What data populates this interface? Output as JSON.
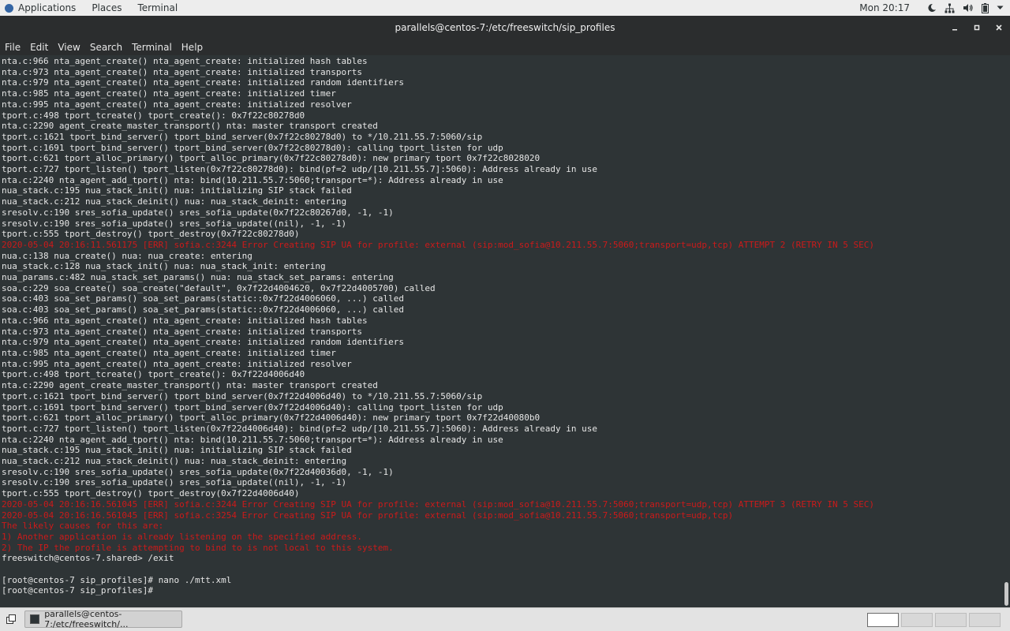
{
  "topbar": {
    "applications": "Applications",
    "places": "Places",
    "terminal": "Terminal",
    "clock": "Mon 20:17"
  },
  "window": {
    "title": "parallels@centos-7:/etc/freeswitch/sip_profiles"
  },
  "menubar": [
    "File",
    "Edit",
    "View",
    "Search",
    "Terminal",
    "Help"
  ],
  "terminal": {
    "lines": [
      {
        "t": "nta.c:966 nta_agent_create() nta_agent_create: initialized hash tables",
        "c": "n"
      },
      {
        "t": "nta.c:973 nta_agent_create() nta_agent_create: initialized transports",
        "c": "n"
      },
      {
        "t": "nta.c:979 nta_agent_create() nta_agent_create: initialized random identifiers",
        "c": "n"
      },
      {
        "t": "nta.c:985 nta_agent_create() nta_agent_create: initialized timer",
        "c": "n"
      },
      {
        "t": "nta.c:995 nta_agent_create() nta_agent_create: initialized resolver",
        "c": "n"
      },
      {
        "t": "tport.c:498 tport_tcreate() tport_create(): 0x7f22c80278d0",
        "c": "n"
      },
      {
        "t": "nta.c:2290 agent_create_master_transport() nta: master transport created",
        "c": "n"
      },
      {
        "t": "tport.c:1621 tport_bind_server() tport_bind_server(0x7f22c80278d0) to */10.211.55.7:5060/sip",
        "c": "n"
      },
      {
        "t": "tport.c:1691 tport_bind_server() tport_bind_server(0x7f22c80278d0): calling tport_listen for udp",
        "c": "n"
      },
      {
        "t": "tport.c:621 tport_alloc_primary() tport_alloc_primary(0x7f22c80278d0): new primary tport 0x7f22c8028020",
        "c": "n"
      },
      {
        "t": "tport.c:727 tport_listen() tport_listen(0x7f22c80278d0): bind(pf=2 udp/[10.211.55.7]:5060): Address already in use",
        "c": "n"
      },
      {
        "t": "nta.c:2240 nta_agent_add_tport() nta: bind(10.211.55.7:5060;transport=*): Address already in use",
        "c": "n"
      },
      {
        "t": "nua_stack.c:195 nua_stack_init() nua: initializing SIP stack failed",
        "c": "n"
      },
      {
        "t": "nua_stack.c:212 nua_stack_deinit() nua: nua_stack_deinit: entering",
        "c": "n"
      },
      {
        "t": "sresolv.c:190 sres_sofia_update() sres_sofia_update(0x7f22c80267d0, -1, -1)",
        "c": "n"
      },
      {
        "t": "sresolv.c:190 sres_sofia_update() sres_sofia_update((nil), -1, -1)",
        "c": "n"
      },
      {
        "t": "tport.c:555 tport_destroy() tport_destroy(0x7f22c80278d0)",
        "c": "n"
      },
      {
        "t": "2020-05-04 20:16:11.561175 [ERR] sofia.c:3244 Error Creating SIP UA for profile: external (sip:mod_sofia@10.211.55.7:5060;transport=udp,tcp) ATTEMPT 2 (RETRY IN 5 SEC)",
        "c": "e"
      },
      {
        "t": "nua.c:138 nua_create() nua: nua_create: entering",
        "c": "n"
      },
      {
        "t": "nua_stack.c:128 nua_stack_init() nua: nua_stack_init: entering",
        "c": "n"
      },
      {
        "t": "nua_params.c:482 nua_stack_set_params() nua: nua_stack_set_params: entering",
        "c": "n"
      },
      {
        "t": "soa.c:229 soa_create() soa_create(\"default\", 0x7f22d4004620, 0x7f22d4005700) called",
        "c": "n"
      },
      {
        "t": "soa.c:403 soa_set_params() soa_set_params(static::0x7f22d4006060, ...) called",
        "c": "n"
      },
      {
        "t": "soa.c:403 soa_set_params() soa_set_params(static::0x7f22d4006060, ...) called",
        "c": "n"
      },
      {
        "t": "nta.c:966 nta_agent_create() nta_agent_create: initialized hash tables",
        "c": "n"
      },
      {
        "t": "nta.c:973 nta_agent_create() nta_agent_create: initialized transports",
        "c": "n"
      },
      {
        "t": "nta.c:979 nta_agent_create() nta_agent_create: initialized random identifiers",
        "c": "n"
      },
      {
        "t": "nta.c:985 nta_agent_create() nta_agent_create: initialized timer",
        "c": "n"
      },
      {
        "t": "nta.c:995 nta_agent_create() nta_agent_create: initialized resolver",
        "c": "n"
      },
      {
        "t": "tport.c:498 tport_tcreate() tport_create(): 0x7f22d4006d40",
        "c": "n"
      },
      {
        "t": "nta.c:2290 agent_create_master_transport() nta: master transport created",
        "c": "n"
      },
      {
        "t": "tport.c:1621 tport_bind_server() tport_bind_server(0x7f22d4006d40) to */10.211.55.7:5060/sip",
        "c": "n"
      },
      {
        "t": "tport.c:1691 tport_bind_server() tport_bind_server(0x7f22d4006d40): calling tport_listen for udp",
        "c": "n"
      },
      {
        "t": "tport.c:621 tport_alloc_primary() tport_alloc_primary(0x7f22d4006d40): new primary tport 0x7f22d40080b0",
        "c": "n"
      },
      {
        "t": "tport.c:727 tport_listen() tport_listen(0x7f22d4006d40): bind(pf=2 udp/[10.211.55.7]:5060): Address already in use",
        "c": "n"
      },
      {
        "t": "nta.c:2240 nta_agent_add_tport() nta: bind(10.211.55.7:5060;transport=*): Address already in use",
        "c": "n"
      },
      {
        "t": "nua_stack.c:195 nua_stack_init() nua: initializing SIP stack failed",
        "c": "n"
      },
      {
        "t": "nua_stack.c:212 nua_stack_deinit() nua: nua_stack_deinit: entering",
        "c": "n"
      },
      {
        "t": "sresolv.c:190 sres_sofia_update() sres_sofia_update(0x7f22d40036d0, -1, -1)",
        "c": "n"
      },
      {
        "t": "sresolv.c:190 sres_sofia_update() sres_sofia_update((nil), -1, -1)",
        "c": "n"
      },
      {
        "t": "tport.c:555 tport_destroy() tport_destroy(0x7f22d4006d40)",
        "c": "n"
      },
      {
        "t": "2020-05-04 20:16:16.561045 [ERR] sofia.c:3244 Error Creating SIP UA for profile: external (sip:mod_sofia@10.211.55.7:5060;transport=udp,tcp) ATTEMPT 3 (RETRY IN 5 SEC)",
        "c": "e"
      },
      {
        "t": "2020-05-04 20:16:16.561045 [ERR] sofia.c:3254 Error Creating SIP UA for profile: external (sip:mod_sofia@10.211.55.7:5060;transport=udp,tcp)",
        "c": "e"
      },
      {
        "t": "The likely causes for this are:",
        "c": "e"
      },
      {
        "t": "1) Another application is already listening on the specified address.",
        "c": "e"
      },
      {
        "t": "2) The IP the profile is attempting to bind to is not local to this system.",
        "c": "e"
      },
      {
        "t": "freeswitch@centos-7.shared> /exit",
        "c": "n"
      },
      {
        "t": "",
        "c": "n"
      },
      {
        "t": "[root@centos-7 sip_profiles]# nano ./mtt.xml",
        "c": "n"
      },
      {
        "t": "[root@centos-7 sip_profiles]#",
        "c": "n"
      }
    ]
  },
  "taskbar": {
    "task_label": "parallels@centos-7:/etc/freeswitch/..."
  },
  "icons": {
    "night": "moon-icon",
    "network": "network-icon",
    "volume": "volume-icon",
    "battery": "battery-icon"
  }
}
